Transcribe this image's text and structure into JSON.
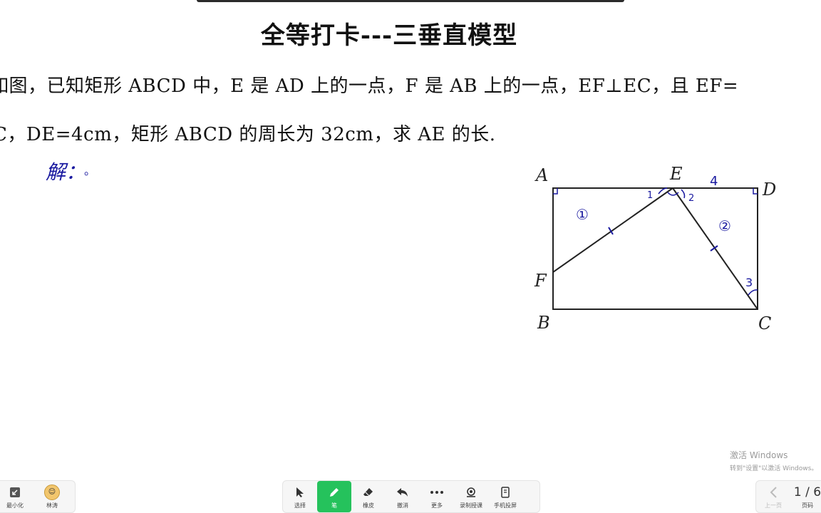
{
  "slide": {
    "title": "全等打卡---三垂直模型",
    "question_line1": "如图，已知矩形 ABCD 中，E 是 AD 上的一点，F 是 AB 上的一点，EF⊥EC，且 EF=",
    "question_line2": "C，DE=4cm，矩形 ABCD 的周长为 32cm，求 AE 的长.",
    "solution_label": "解：",
    "solution_dot": "。"
  },
  "figure": {
    "labels": {
      "A": "A",
      "B": "B",
      "C": "C",
      "D": "D",
      "E": "E",
      "F": "F"
    },
    "annotations": {
      "de_length": "4",
      "angle1": "1",
      "angle2": "2",
      "angle3": "3",
      "region1": "①",
      "region2": "②"
    }
  },
  "watermark": {
    "line1": "激活 Windows",
    "line2": "转到\"设置\"以激活 Windows。"
  },
  "toolbar": {
    "minimize_label": "最小化",
    "user_label": "林涛",
    "select_label": "选择",
    "pen_label": "笔",
    "eraser_label": "橡皮",
    "undo_label": "撤消",
    "more_label": "更多",
    "record_label": "录制授课",
    "mobile_label": "手机投屏",
    "prev_label": "上一页",
    "page_indicator": "1 / 6",
    "page_label": "页码"
  },
  "colors": {
    "pen_active": "#25c25c",
    "annotation": "#1a1aa0"
  }
}
